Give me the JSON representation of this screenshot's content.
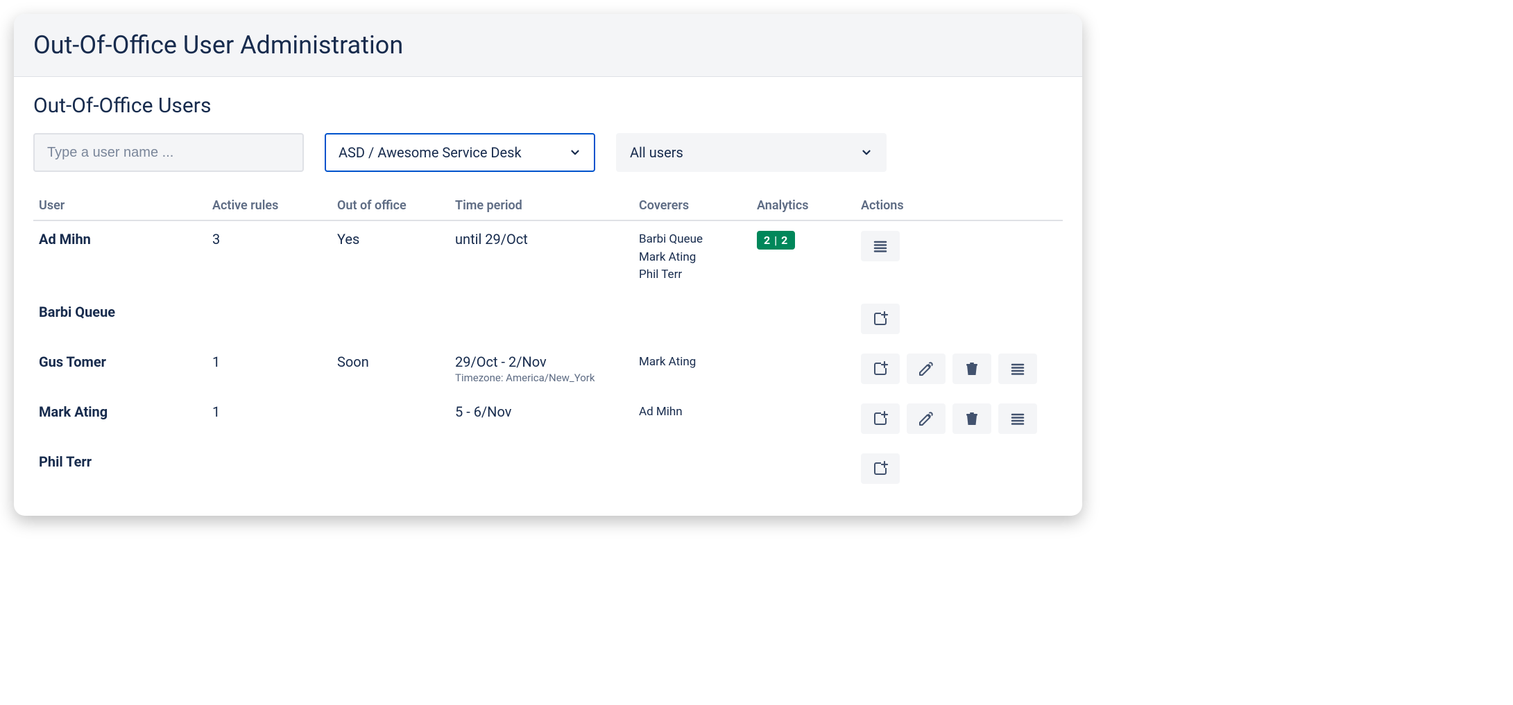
{
  "header": {
    "title": "Out-Of-Office User Administration"
  },
  "subtitle": "Out-Of-Office Users",
  "filters": {
    "search_placeholder": "Type a user name ...",
    "project_selected": "ASD / Awesome Service Desk",
    "scope_selected": "All users"
  },
  "columns": {
    "user": "User",
    "active_rules": "Active rules",
    "out_of_office": "Out of office",
    "time_period": "Time period",
    "coverers": "Coverers",
    "analytics": "Analytics",
    "actions": "Actions"
  },
  "rows": [
    {
      "user": "Ad Mihn",
      "active_rules": "3",
      "out_of_office": "Yes",
      "time_period": "until 29/Oct",
      "timezone": "",
      "coverers": "Barbi Queue\nMark Ating\nPhil Terr",
      "analytics": "2 | 2",
      "actions": [
        "list"
      ]
    },
    {
      "user": "Barbi Queue",
      "active_rules": "",
      "out_of_office": "",
      "time_period": "",
      "timezone": "",
      "coverers": "",
      "analytics": "",
      "actions": [
        "add"
      ]
    },
    {
      "user": "Gus Tomer",
      "active_rules": "1",
      "out_of_office": "Soon",
      "time_period": "29/Oct - 2/Nov",
      "timezone": "Timezone: America/New_York",
      "coverers": "Mark Ating",
      "analytics": "",
      "actions": [
        "add",
        "edit",
        "delete",
        "list"
      ]
    },
    {
      "user": "Mark Ating",
      "active_rules": "1",
      "out_of_office": "",
      "time_period": "5 - 6/Nov",
      "timezone": "",
      "coverers": "Ad Mihn",
      "analytics": "",
      "actions": [
        "add",
        "edit",
        "delete",
        "list"
      ]
    },
    {
      "user": "Phil Terr",
      "active_rules": "",
      "out_of_office": "",
      "time_period": "",
      "timezone": "",
      "coverers": "",
      "analytics": "",
      "actions": [
        "add"
      ]
    }
  ]
}
